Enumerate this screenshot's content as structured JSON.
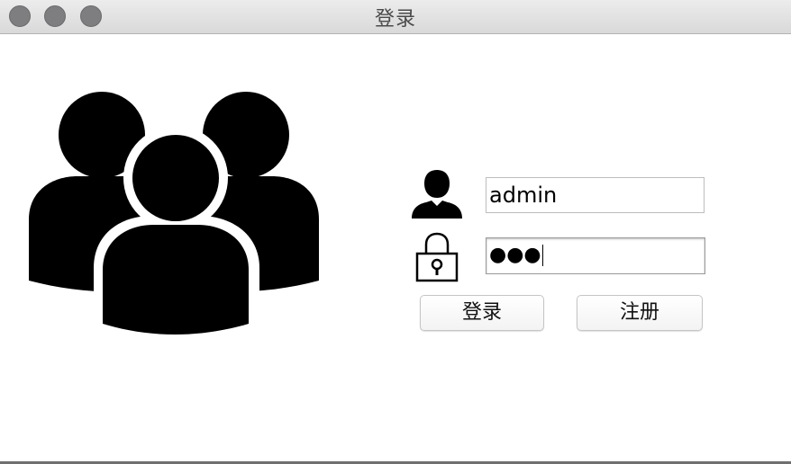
{
  "window": {
    "title": "登录"
  },
  "illustration": {
    "icon": "users-group-icon"
  },
  "form": {
    "username": {
      "icon": "user-icon",
      "value": "admin"
    },
    "password": {
      "icon": "lock-icon",
      "masked_value": "●●●"
    },
    "buttons": {
      "login_label": "登录",
      "register_label": "注册"
    }
  },
  "colors": {
    "titlebar": "#e0e0e0",
    "traffic_light": "#7e7e80",
    "icon_fill": "#000000",
    "field_border": "#bdbdbd"
  }
}
